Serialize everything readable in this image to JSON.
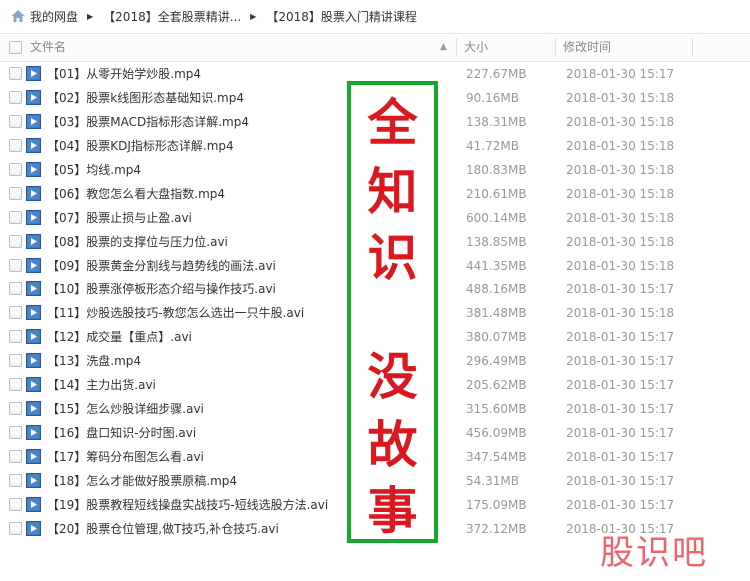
{
  "breadcrumb": [
    "我的网盘",
    "【2018】全套股票精讲...",
    "【2018】股票入门精讲课程"
  ],
  "columns": {
    "name": "文件名",
    "size": "大小",
    "date": "修改时间"
  },
  "files": [
    {
      "name": "【01】从零开始学炒股.mp4",
      "size": "227.67MB",
      "date": "2018-01-30 15:17"
    },
    {
      "name": "【02】股票k线图形态基础知识.mp4",
      "size": "90.16MB",
      "date": "2018-01-30 15:18"
    },
    {
      "name": "【03】股票MACD指标形态详解.mp4",
      "size": "138.31MB",
      "date": "2018-01-30 15:18"
    },
    {
      "name": "【04】股票KDJ指标形态详解.mp4",
      "size": "41.72MB",
      "date": "2018-01-30 15:18"
    },
    {
      "name": "【05】均线.mp4",
      "size": "180.83MB",
      "date": "2018-01-30 15:18"
    },
    {
      "name": "【06】教您怎么看大盘指数.mp4",
      "size": "210.61MB",
      "date": "2018-01-30 15:18"
    },
    {
      "name": "【07】股票止损与止盈.avi",
      "size": "600.14MB",
      "date": "2018-01-30 15:18"
    },
    {
      "name": "【08】股票的支撑位与压力位.avi",
      "size": "138.85MB",
      "date": "2018-01-30 15:18"
    },
    {
      "name": "【09】股票黄金分割线与趋势线的画法.avi",
      "size": "441.35MB",
      "date": "2018-01-30 15:18"
    },
    {
      "name": "【10】股票涨停板形态介绍与操作技巧.avi",
      "size": "488.16MB",
      "date": "2018-01-30 15:17"
    },
    {
      "name": "【11】炒股选股技巧-教您怎么选出一只牛股.avi",
      "size": "381.48MB",
      "date": "2018-01-30 15:18"
    },
    {
      "name": "【12】成交量【重点】.avi",
      "size": "380.07MB",
      "date": "2018-01-30 15:17"
    },
    {
      "name": "【13】洗盘.mp4",
      "size": "296.49MB",
      "date": "2018-01-30 15:17"
    },
    {
      "name": "【14】主力出货.avi",
      "size": "205.62MB",
      "date": "2018-01-30 15:17"
    },
    {
      "name": "【15】怎么炒股详细步骤.avi",
      "size": "315.60MB",
      "date": "2018-01-30 15:17"
    },
    {
      "name": "【16】盘口知识-分时图.avi",
      "size": "456.09MB",
      "date": "2018-01-30 15:17"
    },
    {
      "name": "【17】筹码分布图怎么看.avi",
      "size": "347.54MB",
      "date": "2018-01-30 15:17"
    },
    {
      "name": "【18】怎么才能做好股票原稿.mp4",
      "size": "54.31MB",
      "date": "2018-01-30 15:17"
    },
    {
      "name": "【19】股票教程短线操盘实战技巧-短线选股方法.avi",
      "size": "175.09MB",
      "date": "2018-01-30 15:17"
    },
    {
      "name": "【20】股票仓位管理,做T技巧,补仓技巧.avi",
      "size": "372.12MB",
      "date": "2018-01-30 15:17"
    }
  ],
  "overlay": {
    "chars": [
      "全",
      "知",
      "识",
      "没",
      "故",
      "事"
    ],
    "color": "#d9181f",
    "border_color": "#18a82e"
  },
  "watermark": "股识吧",
  "icons": {
    "home": "home-icon",
    "file": "video-file-icon",
    "sort": "sort-up-arrow-icon"
  }
}
